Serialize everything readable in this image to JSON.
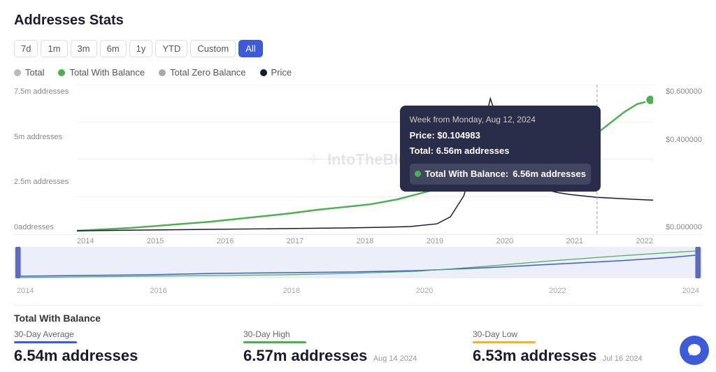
{
  "page": {
    "title": "Addresses Stats"
  },
  "filters": {
    "buttons": [
      "7d",
      "1m",
      "3m",
      "6m",
      "1y",
      "YTD",
      "Custom",
      "All"
    ],
    "active": "All"
  },
  "legend": {
    "items": [
      {
        "label": "Total",
        "color": "#aaa",
        "type": "dot"
      },
      {
        "label": "Total With Balance",
        "color": "#4caf50",
        "type": "dot"
      },
      {
        "label": "Total Zero Balance",
        "color": "#bbb",
        "type": "dot"
      },
      {
        "label": "Price",
        "color": "#1a1a2e",
        "type": "dot"
      }
    ]
  },
  "yaxis_left": [
    "7.5m addresses",
    "5m addresses",
    "2.5m addresses",
    "0addresses"
  ],
  "yaxis_right": [
    "$0.600000",
    "$0.400000",
    "",
    "$0.000000"
  ],
  "xaxis": [
    "2014",
    "2015",
    "2016",
    "2017",
    "2018",
    "2019",
    "2020",
    "2021",
    "2022"
  ],
  "mini_xaxis": [
    "2014",
    "2016",
    "2018",
    "2020",
    "2022",
    "2024"
  ],
  "tooltip": {
    "title": "Week from Monday, Aug 12, 2024",
    "price_label": "Price:",
    "price_value": "$0.104983",
    "total_label": "Total:",
    "total_value": "6.56m addresses",
    "highlight_label": "Total With Balance:",
    "highlight_value": "6.56m addresses",
    "dot_color": "#4caf50"
  },
  "watermark": "IntoTheBlock",
  "stats": {
    "section_label": "Total With Balance",
    "items": [
      {
        "header": "30-Day Average",
        "underline_color": "#3b5bdb",
        "value": "6.54m addresses",
        "date": ""
      },
      {
        "header": "30-Day High",
        "underline_color": "#4caf50",
        "value": "6.57m addresses",
        "date": "Aug 14 2024"
      },
      {
        "header": "30-Day Low",
        "underline_color": "#f0b429",
        "value": "6.53m addresses",
        "date": "Jul 16 2024"
      }
    ]
  }
}
